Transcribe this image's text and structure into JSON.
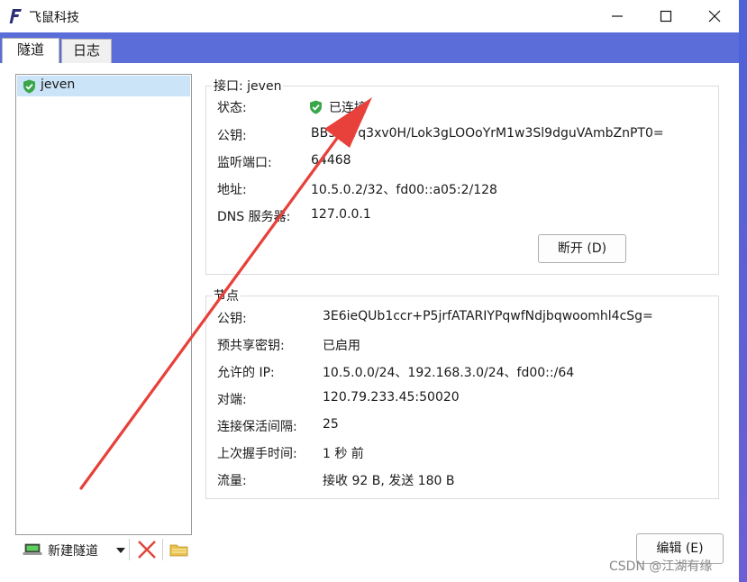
{
  "window": {
    "title": "飞鼠科技"
  },
  "tabs": [
    {
      "label": "隧道"
    },
    {
      "label": "日志"
    }
  ],
  "tunnels": [
    {
      "name": "jeven",
      "status": "connected"
    }
  ],
  "toolbar": {
    "new_tunnel_label": "新建隧道",
    "edit_label": "编辑 (E)"
  },
  "interface": {
    "title": "接口: jeven",
    "rows": [
      {
        "label": "状态:",
        "value": "已连接"
      },
      {
        "label": "公钥:",
        "value": "BB3+iYq3xv0H/Lok3gLOOoYrM1w3Sl9dguVAmbZnPT0="
      },
      {
        "label": "监听端口:",
        "value": "64468"
      },
      {
        "label": "地址:",
        "value": "10.5.0.2/32、fd00::a05:2/128"
      },
      {
        "label": "DNS 服务器:",
        "value": "127.0.0.1"
      }
    ],
    "disconnect_label": "断开 (D)"
  },
  "peer": {
    "title": "节点",
    "rows": [
      {
        "label": "公钥:",
        "value": "3E6ieQUb1ccr+P5jrfATARIYPqwfNdjbqwoomhl4cSg="
      },
      {
        "label": "预共享密钥:",
        "value": "已启用"
      },
      {
        "label": "允许的 IP:",
        "value": "10.5.0.0/24、192.168.3.0/24、fd00::/64"
      },
      {
        "label": "对端:",
        "value": "120.79.233.45:50020"
      },
      {
        "label": "连接保活间隔:",
        "value": "25"
      },
      {
        "label": "上次握手时间:",
        "value": "1 秒 前"
      },
      {
        "label": "流量:",
        "value": "接收 92 B, 发送 180 B"
      }
    ]
  },
  "watermark": "CSDN @江湖有缘",
  "colors": {
    "accent": "#5b6dd9",
    "selection": "#cce4f7",
    "arrow": "#e8403a",
    "shield": "#3aa64a"
  }
}
